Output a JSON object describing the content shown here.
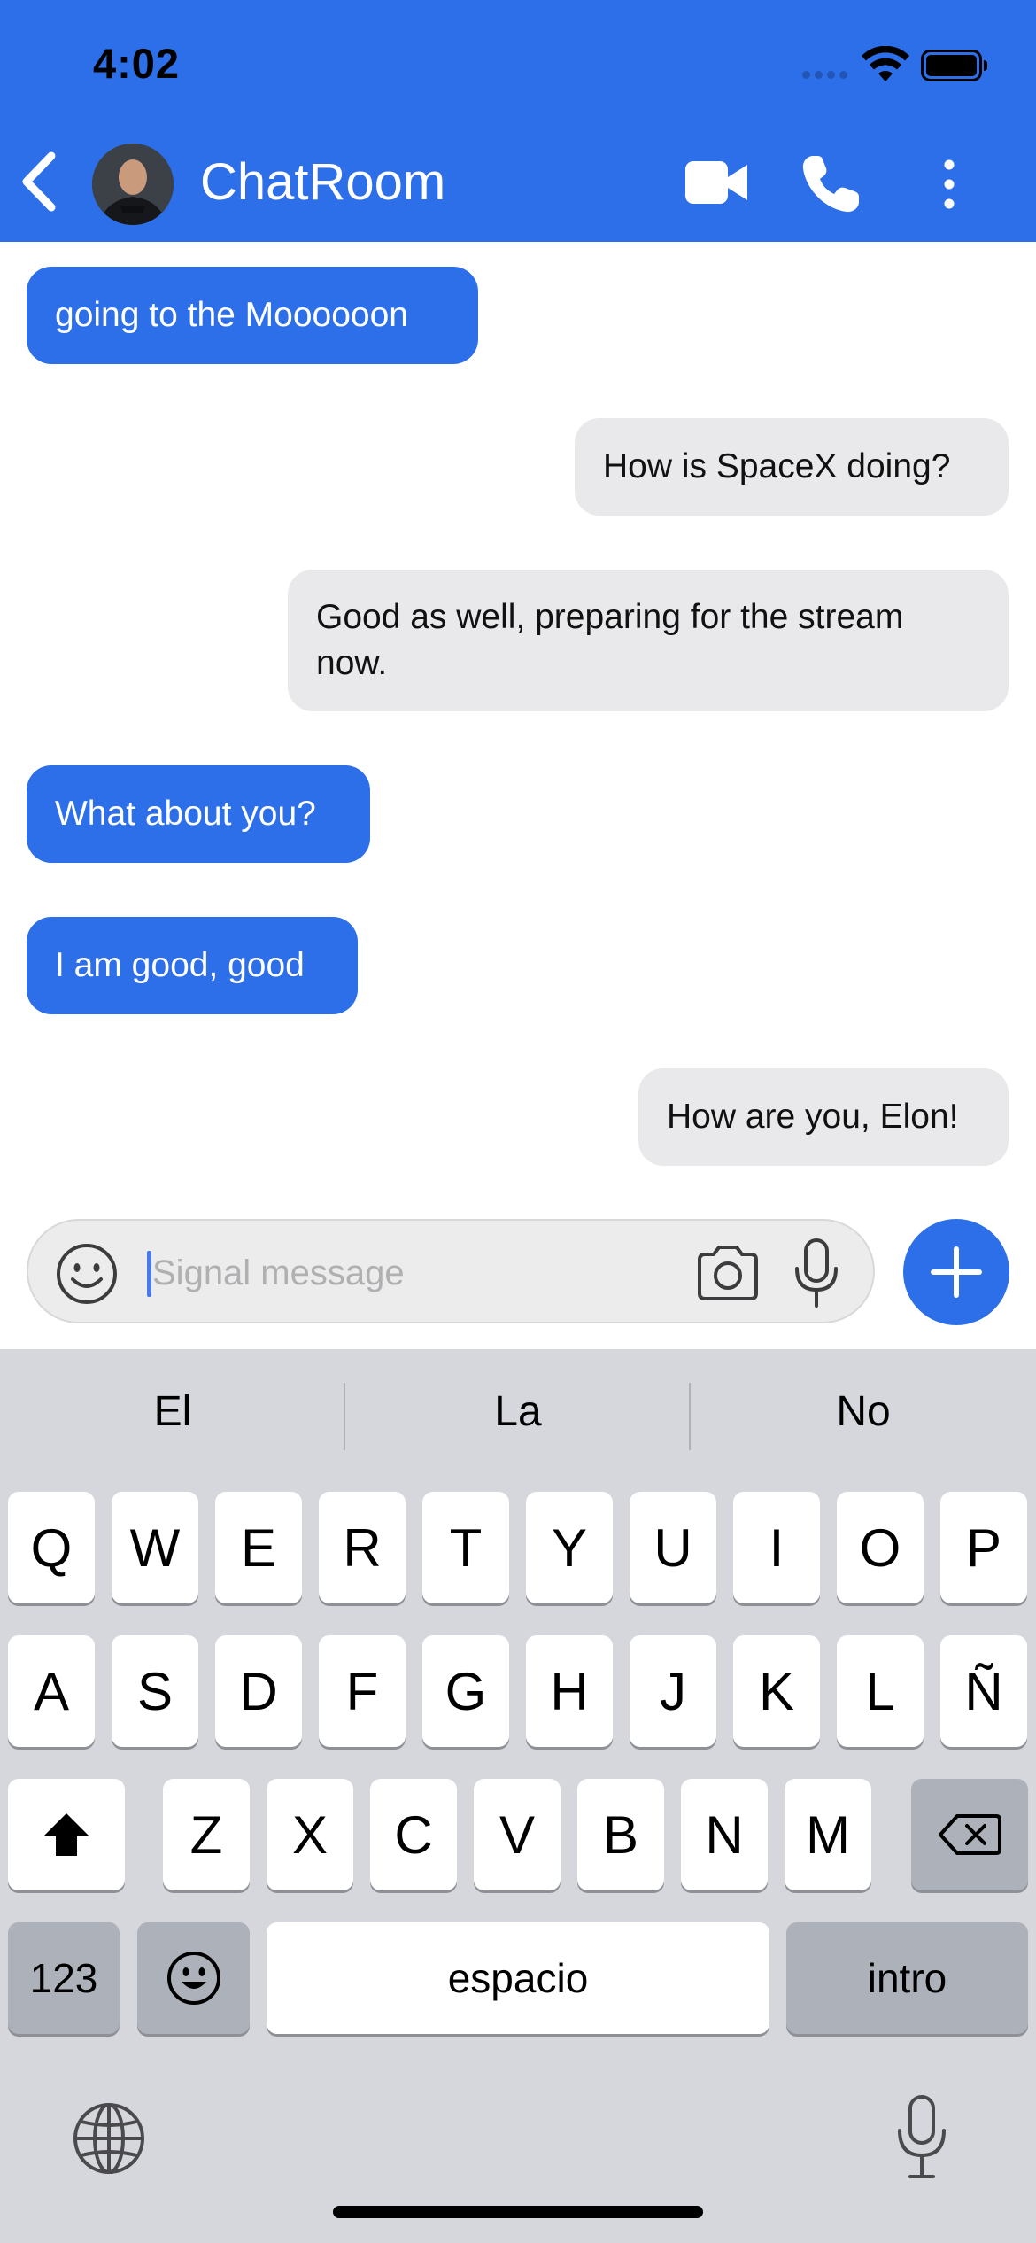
{
  "status_bar": {
    "time": "4:02"
  },
  "header": {
    "title": "ChatRoom",
    "back_icon": "chevron-left-icon",
    "video_icon": "video-camera-icon",
    "call_icon": "phone-icon",
    "more_icon": "more-vertical-icon"
  },
  "messages": [
    {
      "direction": "incoming",
      "text": "going to the Moooooon"
    },
    {
      "direction": "outgoing",
      "text": "How is SpaceX doing?"
    },
    {
      "direction": "outgoing",
      "text": "Good as well, preparing for the stream now."
    },
    {
      "direction": "incoming",
      "text": "What about you?"
    },
    {
      "direction": "incoming",
      "text": "I am good, good"
    },
    {
      "direction": "outgoing",
      "text": "How are you, Elon!"
    }
  ],
  "composer": {
    "placeholder": "Signal message",
    "value": ""
  },
  "keyboard": {
    "suggestions": [
      "El",
      "La",
      "No"
    ],
    "row1": [
      "Q",
      "W",
      "E",
      "R",
      "T",
      "Y",
      "U",
      "I",
      "O",
      "P"
    ],
    "row2": [
      "A",
      "S",
      "D",
      "F",
      "G",
      "H",
      "J",
      "K",
      "L",
      "Ñ"
    ],
    "row3": [
      "Z",
      "X",
      "C",
      "V",
      "B",
      "N",
      "M"
    ],
    "numbers_label": "123",
    "space_label": "espacio",
    "return_label": "intro"
  },
  "colors": {
    "accent": "#2d6fe8",
    "incoming_bubble": "#2d6fe8",
    "outgoing_bubble": "#e9e9eb",
    "keyboard_bg": "#d5d7dc"
  }
}
